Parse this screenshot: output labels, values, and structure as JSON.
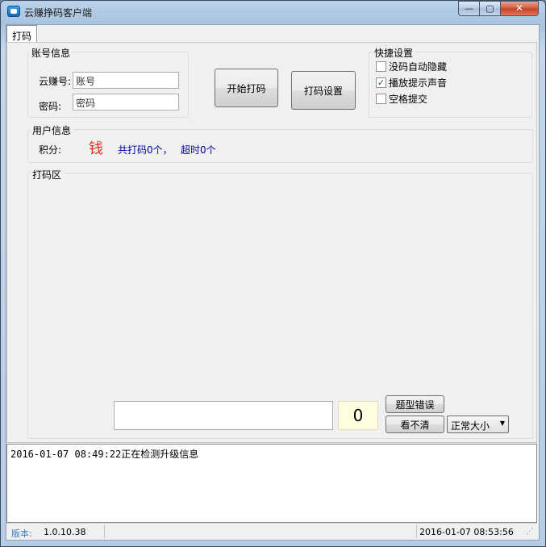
{
  "window": {
    "title": "云赚挣码客户端",
    "min_label": "—",
    "max_label": "▢",
    "close_label": "✕"
  },
  "tabs": [
    {
      "label": "打码"
    }
  ],
  "account": {
    "group_title": "账号信息",
    "username_label": "云赚号:",
    "username_value": "账号",
    "password_label": "密码:",
    "password_value": "密码"
  },
  "actions": {
    "start_label": "开始打码",
    "settings_label": "打码设置"
  },
  "quick_settings": {
    "group_title": "快捷设置",
    "options": [
      {
        "label": "没码自动隐藏",
        "checked": false
      },
      {
        "label": "播放提示声音",
        "checked": true
      },
      {
        "label": "空格提交",
        "checked": false
      }
    ]
  },
  "user_info": {
    "group_title": "用户信息",
    "points_label": "积分:",
    "money_glyph": "钱",
    "total_text": "共打码0个，",
    "timeout_text": "超时0个"
  },
  "work_area": {
    "group_title": "打码区",
    "answer_value": "",
    "counter": "0",
    "wrong_type_label": "题型错误",
    "unclear_label": "看不清",
    "size_select_value": "正常大小"
  },
  "log": {
    "lines": [
      "2016-01-07 08:49:22正在检测升级信息"
    ]
  },
  "status_bar": {
    "version_label": "版本:",
    "version_value": "1.0.10.38",
    "datetime": "2016-01-07 08:53:56"
  },
  "colors": {
    "money_red": "#e8321e",
    "info_blue": "#0000a8",
    "counter_bg": "#ffffe0"
  },
  "icons": [
    "app-icon",
    "minimize-icon",
    "maximize-icon",
    "close-icon",
    "checkbox-checked-icon",
    "dropdown-arrow-icon",
    "resize-grip-icon"
  ]
}
